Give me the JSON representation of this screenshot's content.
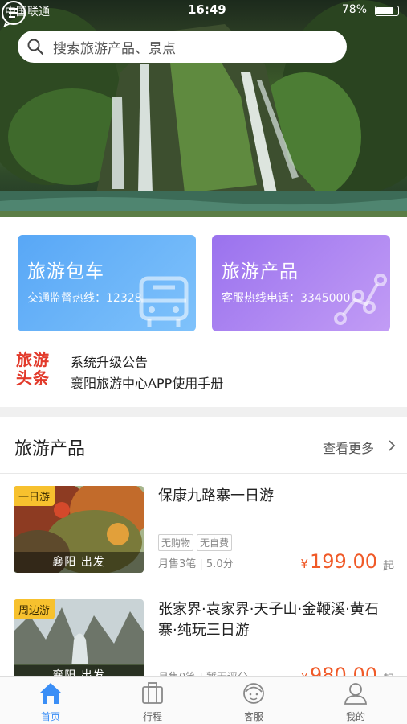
{
  "status_bar": {
    "carrier": "中国联通",
    "time": "16:49",
    "battery": "78%"
  },
  "search": {
    "placeholder": "搜索旅游产品、景点",
    "icon": "search-icon"
  },
  "message_button": {
    "icon": "message-icon"
  },
  "cards": [
    {
      "title": "旅游包车",
      "subtitle": "交通监督热线：12328",
      "icon": "bus-icon",
      "color": "#58a7f6"
    },
    {
      "title": "旅游产品",
      "subtitle": "客服热线电话：3345000",
      "icon": "route-icon",
      "color": "#9a72ee"
    }
  ],
  "headlines": {
    "logo": "旅游头条",
    "items": [
      "系统升级公告",
      "襄阳旅游中心APP使用手册"
    ]
  },
  "products_section": {
    "title": "旅游产品",
    "more_label": "查看更多"
  },
  "products": [
    {
      "tag": "一日游",
      "location": "襄阳 出发",
      "name": "保康九路寨一日游",
      "badges": [
        "无购物",
        "无自费"
      ],
      "sales": "月售3笔 | 5.0分",
      "currency": "¥",
      "price": "199.00",
      "price_suffix": "起"
    },
    {
      "tag": "周边游",
      "location": "襄阳 出发",
      "name": "张家界·袁家界·天子山·金鞭溪·黄石寨·纯玩三日游",
      "badges": [],
      "sales": "月售0笔 | 暂无评分",
      "currency": "¥",
      "price": "980.00",
      "price_suffix": "起"
    }
  ],
  "tabbar": [
    {
      "label": "首页",
      "icon": "home-icon",
      "active": true
    },
    {
      "label": "行程",
      "icon": "suitcase-icon",
      "active": false
    },
    {
      "label": "客服",
      "icon": "support-icon",
      "active": false
    },
    {
      "label": "我的",
      "icon": "user-icon",
      "active": false
    }
  ],
  "colors": {
    "accent": "#3a8ef6",
    "price": "#f05a28",
    "tag": "#f7c12e",
    "headline_logo": "#e23a2b"
  }
}
